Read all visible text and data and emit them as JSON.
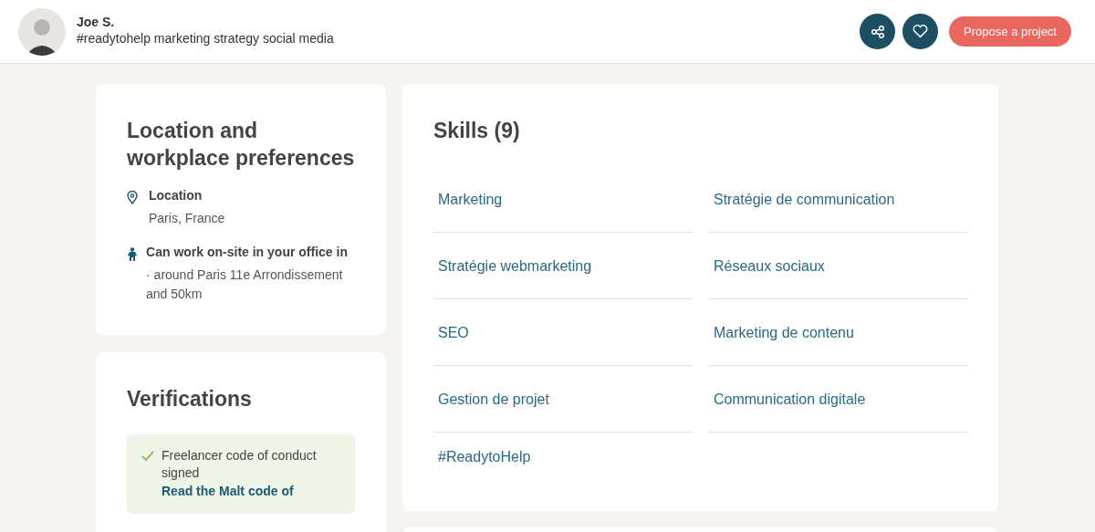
{
  "header": {
    "name": "Joe S.",
    "tagline": "#readytohelp marketing strategy social media",
    "cta": "Propose a project"
  },
  "location_card": {
    "title": "Location and workplace preferences",
    "items": [
      {
        "kind": "pin",
        "label": "Location",
        "lines": [
          "Paris, France"
        ]
      },
      {
        "kind": "person",
        "label": "Can work on-site in your office in",
        "lines": [
          "· around Paris 11e Arrondissement and 50km"
        ]
      }
    ]
  },
  "verifications": {
    "title": "Verifications",
    "items": [
      {
        "text": "Freelancer code of conduct signed",
        "link": "Read the Malt code of"
      }
    ]
  },
  "skills": {
    "title": "Skills (9)",
    "items": [
      {
        "label": "Marketing"
      },
      {
        "label": "Stratégie de communication"
      },
      {
        "label": "Stratégie webmarketing"
      },
      {
        "label": "Réseaux sociaux"
      },
      {
        "label": "SEO"
      },
      {
        "label": "Marketing de contenu"
      },
      {
        "label": "Gestion de projet"
      },
      {
        "label": "Communication digitale"
      },
      {
        "label": "#ReadytoHelp"
      }
    ]
  }
}
